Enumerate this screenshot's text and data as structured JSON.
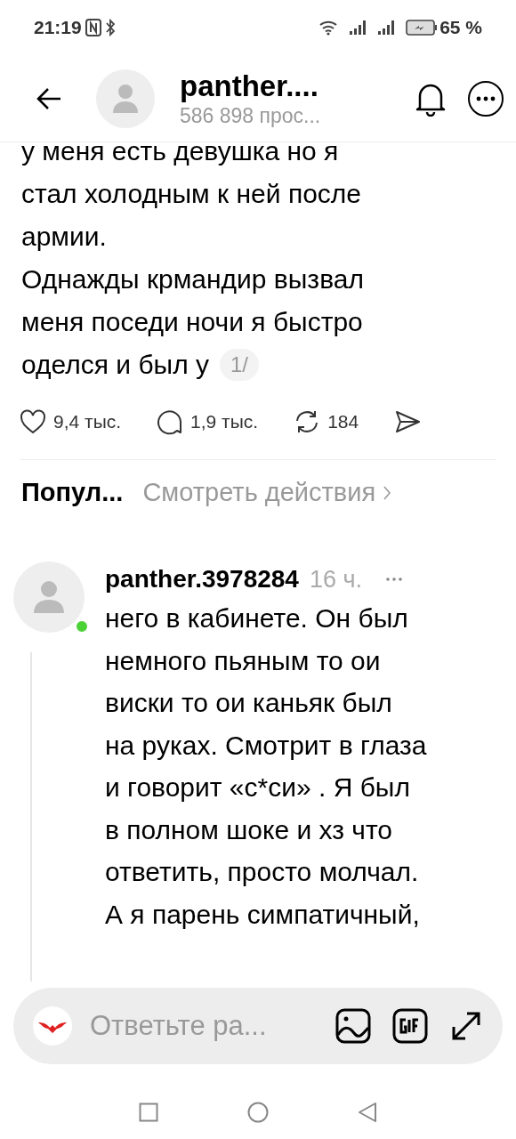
{
  "status_bar": {
    "time": "21:19",
    "battery": "65 %"
  },
  "header": {
    "title": "panther....",
    "subtitle": "586 898 прос..."
  },
  "post": {
    "lines": [
      "у меня есть девушка но я",
      "стал холодным к ней после",
      "армии.",
      "Однажды крмандир вызвал",
      "меня поседи ночи я быстро",
      "оделся и был у"
    ],
    "page_badge": "1/",
    "actions": [
      {
        "kind": "like",
        "count": "9,4 тыс."
      },
      {
        "kind": "comment",
        "count": "1,9 тыс."
      },
      {
        "kind": "repost",
        "count": "184"
      },
      {
        "kind": "share"
      }
    ]
  },
  "sort_bar": {
    "label": "Попул...",
    "link": "Смотреть действия"
  },
  "comment": {
    "username": "panther.3978284",
    "time": "16 ч.",
    "online": true,
    "lines": [
      "него в кабинете. Он был",
      "немного пьяным то ои",
      "виски то ои каньяк был",
      "на руках. Смотрит в глаза",
      "и говорит «с*си» . Я был",
      "в полном шоке и хз что",
      "ответить, просто молчал.",
      "А я парень симпатичный,"
    ]
  },
  "reply_bar": {
    "placeholder": "Ответьте ра..."
  }
}
